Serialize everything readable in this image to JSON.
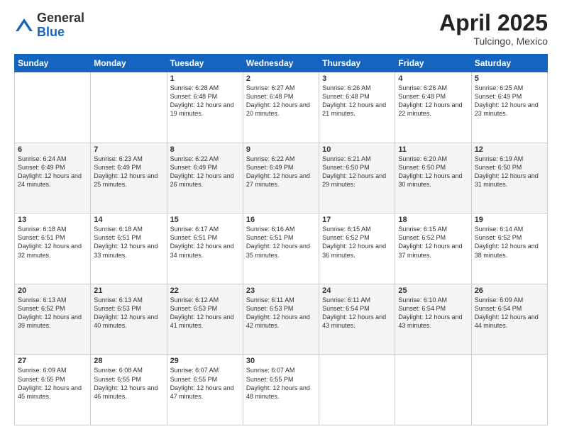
{
  "header": {
    "logo_general": "General",
    "logo_blue": "Blue",
    "title": "April 2025",
    "location": "Tulcingo, Mexico"
  },
  "weekdays": [
    "Sunday",
    "Monday",
    "Tuesday",
    "Wednesday",
    "Thursday",
    "Friday",
    "Saturday"
  ],
  "weeks": [
    [
      {
        "num": "",
        "info": ""
      },
      {
        "num": "",
        "info": ""
      },
      {
        "num": "1",
        "info": "Sunrise: 6:28 AM\nSunset: 6:48 PM\nDaylight: 12 hours and 19 minutes."
      },
      {
        "num": "2",
        "info": "Sunrise: 6:27 AM\nSunset: 6:48 PM\nDaylight: 12 hours and 20 minutes."
      },
      {
        "num": "3",
        "info": "Sunrise: 6:26 AM\nSunset: 6:48 PM\nDaylight: 12 hours and 21 minutes."
      },
      {
        "num": "4",
        "info": "Sunrise: 6:26 AM\nSunset: 6:48 PM\nDaylight: 12 hours and 22 minutes."
      },
      {
        "num": "5",
        "info": "Sunrise: 6:25 AM\nSunset: 6:49 PM\nDaylight: 12 hours and 23 minutes."
      }
    ],
    [
      {
        "num": "6",
        "info": "Sunrise: 6:24 AM\nSunset: 6:49 PM\nDaylight: 12 hours and 24 minutes."
      },
      {
        "num": "7",
        "info": "Sunrise: 6:23 AM\nSunset: 6:49 PM\nDaylight: 12 hours and 25 minutes."
      },
      {
        "num": "8",
        "info": "Sunrise: 6:22 AM\nSunset: 6:49 PM\nDaylight: 12 hours and 26 minutes."
      },
      {
        "num": "9",
        "info": "Sunrise: 6:22 AM\nSunset: 6:49 PM\nDaylight: 12 hours and 27 minutes."
      },
      {
        "num": "10",
        "info": "Sunrise: 6:21 AM\nSunset: 6:50 PM\nDaylight: 12 hours and 29 minutes."
      },
      {
        "num": "11",
        "info": "Sunrise: 6:20 AM\nSunset: 6:50 PM\nDaylight: 12 hours and 30 minutes."
      },
      {
        "num": "12",
        "info": "Sunrise: 6:19 AM\nSunset: 6:50 PM\nDaylight: 12 hours and 31 minutes."
      }
    ],
    [
      {
        "num": "13",
        "info": "Sunrise: 6:18 AM\nSunset: 6:51 PM\nDaylight: 12 hours and 32 minutes."
      },
      {
        "num": "14",
        "info": "Sunrise: 6:18 AM\nSunset: 6:51 PM\nDaylight: 12 hours and 33 minutes."
      },
      {
        "num": "15",
        "info": "Sunrise: 6:17 AM\nSunset: 6:51 PM\nDaylight: 12 hours and 34 minutes."
      },
      {
        "num": "16",
        "info": "Sunrise: 6:16 AM\nSunset: 6:51 PM\nDaylight: 12 hours and 35 minutes."
      },
      {
        "num": "17",
        "info": "Sunrise: 6:15 AM\nSunset: 6:52 PM\nDaylight: 12 hours and 36 minutes."
      },
      {
        "num": "18",
        "info": "Sunrise: 6:15 AM\nSunset: 6:52 PM\nDaylight: 12 hours and 37 minutes."
      },
      {
        "num": "19",
        "info": "Sunrise: 6:14 AM\nSunset: 6:52 PM\nDaylight: 12 hours and 38 minutes."
      }
    ],
    [
      {
        "num": "20",
        "info": "Sunrise: 6:13 AM\nSunset: 6:52 PM\nDaylight: 12 hours and 39 minutes."
      },
      {
        "num": "21",
        "info": "Sunrise: 6:13 AM\nSunset: 6:53 PM\nDaylight: 12 hours and 40 minutes."
      },
      {
        "num": "22",
        "info": "Sunrise: 6:12 AM\nSunset: 6:53 PM\nDaylight: 12 hours and 41 minutes."
      },
      {
        "num": "23",
        "info": "Sunrise: 6:11 AM\nSunset: 6:53 PM\nDaylight: 12 hours and 42 minutes."
      },
      {
        "num": "24",
        "info": "Sunrise: 6:11 AM\nSunset: 6:54 PM\nDaylight: 12 hours and 43 minutes."
      },
      {
        "num": "25",
        "info": "Sunrise: 6:10 AM\nSunset: 6:54 PM\nDaylight: 12 hours and 43 minutes."
      },
      {
        "num": "26",
        "info": "Sunrise: 6:09 AM\nSunset: 6:54 PM\nDaylight: 12 hours and 44 minutes."
      }
    ],
    [
      {
        "num": "27",
        "info": "Sunrise: 6:09 AM\nSunset: 6:55 PM\nDaylight: 12 hours and 45 minutes."
      },
      {
        "num": "28",
        "info": "Sunrise: 6:08 AM\nSunset: 6:55 PM\nDaylight: 12 hours and 46 minutes."
      },
      {
        "num": "29",
        "info": "Sunrise: 6:07 AM\nSunset: 6:55 PM\nDaylight: 12 hours and 47 minutes."
      },
      {
        "num": "30",
        "info": "Sunrise: 6:07 AM\nSunset: 6:55 PM\nDaylight: 12 hours and 48 minutes."
      },
      {
        "num": "",
        "info": ""
      },
      {
        "num": "",
        "info": ""
      },
      {
        "num": "",
        "info": ""
      }
    ]
  ]
}
